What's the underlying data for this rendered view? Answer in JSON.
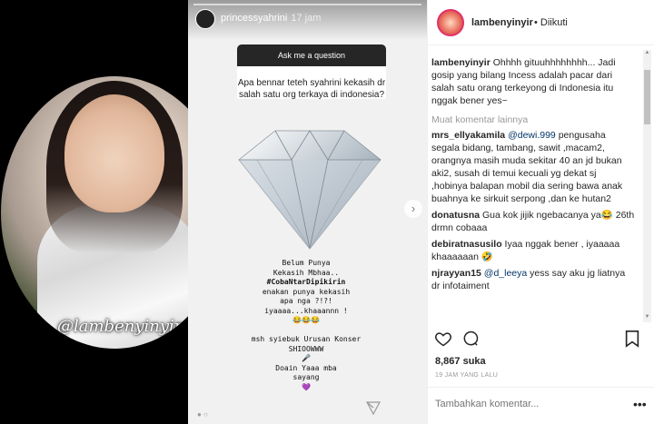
{
  "left": {
    "watermark": "@lambenyinyir"
  },
  "story": {
    "username": "princessyahrini",
    "time": "17 jam",
    "ask_label": "Ask me a question",
    "question": "Apa bennar teteh syahrini kekasih dr salah satu org terkaya di indonesia?",
    "caption_lines": [
      "Belum Punya",
      "Kekasih Mbhaa..",
      "#CobaNtarDipikirin",
      "enakan punya kekasih",
      "apa nga ?!?!",
      "iyaaaa...khaaannn !",
      "😂😂😂",
      "",
      "msh syiebuk Urusan Konser",
      "SHIOOWWW",
      "🎤",
      "Doain Yaaa mba",
      "sayang",
      "💜"
    ]
  },
  "panel": {
    "header": {
      "username": "lambenyinyir",
      "follow_status": "• Diikuti"
    },
    "caption": {
      "user": "lambenyinyir",
      "text": "Ohhhh gituuhhhhhhhh... Jadi gosip yang bilang Incess adalah pacar dari salah satu orang terkeyong di Indonesia itu nggak bener yes~"
    },
    "more_comments": "Muat komentar lainnya",
    "comments": [
      {
        "user": "mrs_ellyakamila",
        "mention": "@dewi.999",
        "text": " pengusaha segala bidang, tambang, sawit ,macam2, orangnya masih muda sekitar 40 an jd bukan aki2, susah di temui kecuali yg dekat sj ,hobinya balapan mobil dia sering bawa anak buahnya ke sirkuit serpong ,dan ke hutan2"
      },
      {
        "user": "donatusna",
        "mention": "",
        "text": " Gua kok jijik ngebacanya ya😂 26th drmn cobaaa"
      },
      {
        "user": "debiratnasusilo",
        "mention": "",
        "text": " Iyaa nggak bener , iyaaaaa khaaaaaan 🤣"
      },
      {
        "user": "njrayyan15",
        "mention": "@d_leeya",
        "text": " yess say aku jg liatnya dr infotaiment"
      }
    ],
    "likes": "8,867 suka",
    "date": "19 JAM YANG LALU",
    "add_comment_placeholder": "Tambahkan komentar..."
  },
  "icons": {
    "like": "heart-icon",
    "comment": "comment-icon",
    "save": "bookmark-icon",
    "more": "ellipsis-icon"
  }
}
